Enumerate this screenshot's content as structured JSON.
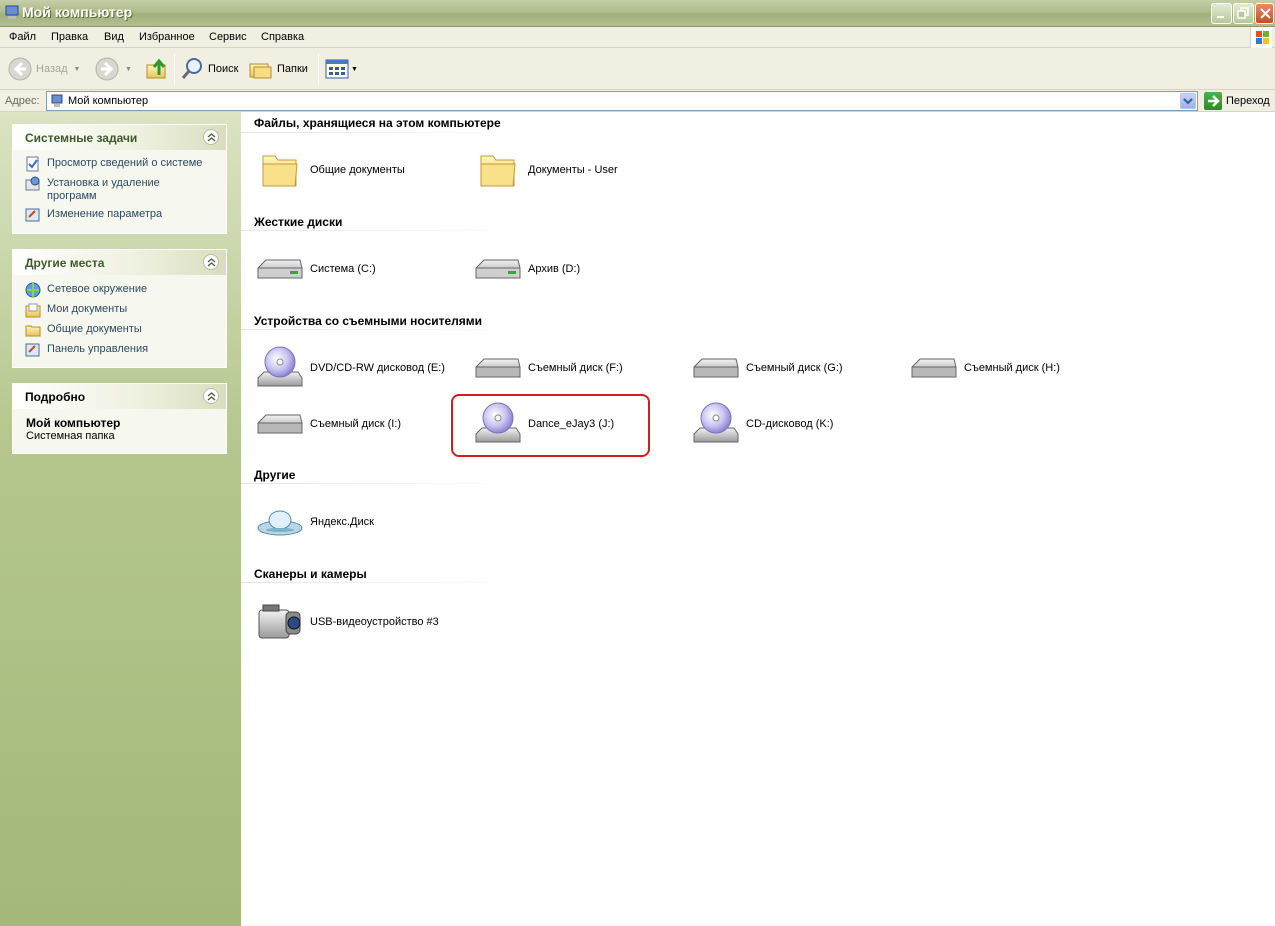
{
  "window": {
    "title": "Мой компьютер",
    "colors": {
      "titlebar": "#a9b785",
      "sidebar": "#b5c78e",
      "highlight": "#cc1f1f"
    }
  },
  "menu": {
    "items": [
      "Файл",
      "Правка",
      "Вид",
      "Избранное",
      "Сервис",
      "Справка"
    ]
  },
  "toolbar": {
    "back_label": "Назад",
    "search_label": "Поиск",
    "folders_label": "Папки"
  },
  "address": {
    "label": "Адрес:",
    "value": "Мой компьютер",
    "go_label": "Переход"
  },
  "sidebar": {
    "system_tasks": {
      "title": "Системные задачи",
      "items": [
        "Просмотр сведений о системе",
        "Установка и удаление программ",
        "Изменение параметра"
      ]
    },
    "other_places": {
      "title": "Другие места",
      "items": [
        "Сетевое окружение",
        "Мои документы",
        "Общие документы",
        "Панель управления"
      ]
    },
    "details": {
      "title": "Подробно",
      "name": "Мой компьютер",
      "type": "Системная папка"
    }
  },
  "groups": [
    {
      "title": "Файлы, хранящиеся на этом компьютере",
      "items": [
        {
          "label": "Общие документы",
          "icon": "folder-icon"
        },
        {
          "label": "Документы - User",
          "icon": "folder-icon"
        }
      ]
    },
    {
      "title": "Жесткие диски",
      "items": [
        {
          "label": "Система (C:)",
          "icon": "hard-drive-icon"
        },
        {
          "label": "Архив (D:)",
          "icon": "hard-drive-icon"
        }
      ]
    },
    {
      "title": "Устройства со съемными носителями",
      "items": [
        {
          "label": "DVD/CD-RW дисковод (E:)",
          "icon": "cd-drive-icon"
        },
        {
          "label": "Съемный диск (F:)",
          "icon": "removable-drive-icon"
        },
        {
          "label": "Съемный диск (G:)",
          "icon": "removable-drive-icon"
        },
        {
          "label": "Съемный диск (H:)",
          "icon": "removable-drive-icon"
        },
        {
          "label": "Съемный диск (I:)",
          "icon": "removable-drive-icon"
        },
        {
          "label": "Dance_eJay3 (J:)",
          "icon": "cd-drive-icon"
        },
        {
          "label": "CD-дисковод (K:)",
          "icon": "cd-drive-icon"
        }
      ]
    },
    {
      "title": "Другие",
      "items": [
        {
          "label": "Яндекс.Диск",
          "icon": "ufo-icon"
        }
      ]
    },
    {
      "title": "Сканеры и камеры",
      "items": [
        {
          "label": "USB-видеоустройство #3",
          "icon": "camera-icon"
        }
      ]
    }
  ]
}
